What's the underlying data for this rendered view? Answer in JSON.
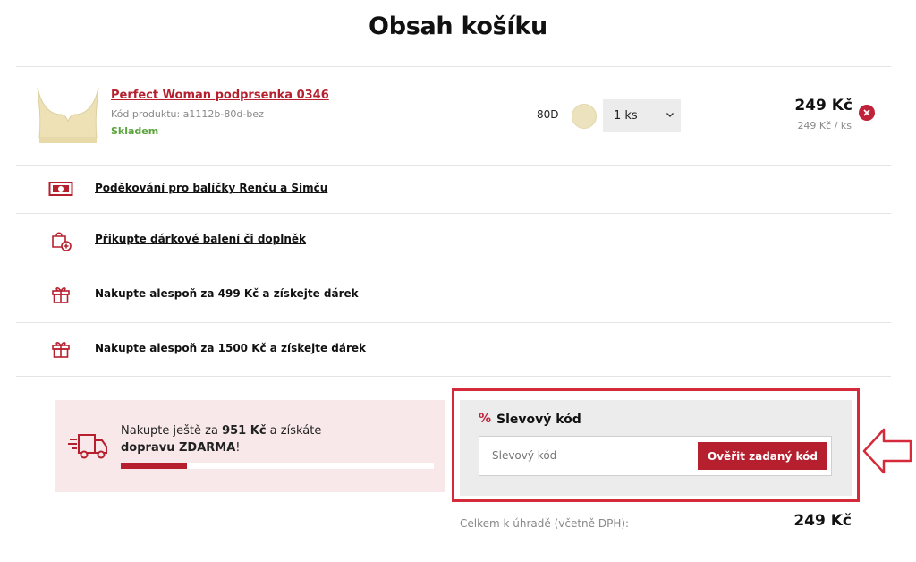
{
  "page": {
    "title": "Obsah košíku"
  },
  "product": {
    "image_icon": "bra-product-image",
    "name": "Perfect Woman podprsenka 0346",
    "code": "Kód produktu: a1112b-80d-bez",
    "stock": "Skladem",
    "size": "80D",
    "color_hex": "#ece2bd",
    "quantity": "1 ks",
    "price_total": "249 Kč",
    "price_unit": "249 Kč / ks"
  },
  "rows": [
    {
      "icon": "banknote-icon",
      "text": "Poděkování pro balíčky Renču a Simču",
      "link": true
    },
    {
      "icon": "gift-bag-plus-icon",
      "text": "Přikupte dárkové balení či doplněk",
      "link": true
    },
    {
      "icon": "gift-icon",
      "text": "Nakupte alespoň za 499 Kč a získejte dárek",
      "link": false
    },
    {
      "icon": "gift-icon",
      "text": "Nakupte alespoň za 1500 Kč a získejte dárek",
      "link": false
    }
  ],
  "shipping": {
    "text_before": "Nakupte ještě za ",
    "amount": "951 Kč",
    "text_middle": " a získáte ",
    "highlight": "dopravu ZDARMA",
    "text_after": "!",
    "progress_fraction": 0.21,
    "icon": "delivery-truck-icon"
  },
  "discount": {
    "icon": "%",
    "title": "Slevový kód",
    "placeholder": "Slevový kód",
    "value": "",
    "button_label": "Ověřit zadaný kód"
  },
  "summary": {
    "label": "Celkem k úhradě (včetně DPH):",
    "total": "249 Kč"
  },
  "colors": {
    "accent": "#b6202e",
    "highlight_border": "#d42a3a",
    "stock_green": "#5aa33c"
  }
}
